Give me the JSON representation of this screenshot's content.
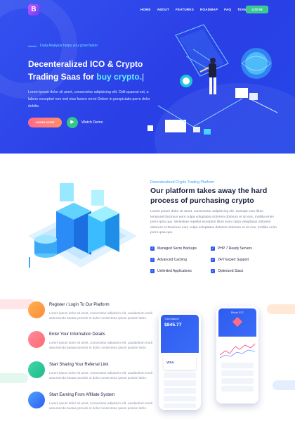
{
  "brand": {
    "logo_letter": "B"
  },
  "nav": {
    "items": [
      "HOME",
      "ABOUT",
      "FEATURES",
      "ROADMAP",
      "FAQ",
      "TEAM"
    ],
    "login_label": "LOG IN"
  },
  "hero": {
    "eyebrow": "Data Analysis helps you grow faster",
    "title_line1": "Decenteralized ICO & Crypto",
    "title_line2_prefix": "Trading Saas for ",
    "title_line2_accent": "buy crypto.",
    "paragraph": "Lorem ipsum dolor sit amet, consectetur adipisicing elit. Odit quaerat est, a labore excepturi rem sed eius facere errori Dolore in perspiciatis porro dolor debitis.",
    "learn_more": "LEARN MORE",
    "watch_demo": "Watch Demo"
  },
  "platform": {
    "eyebrow": "Decenteralized Crypto Trading Platform",
    "heading": "Our platform takes away the hard process of purchasing crypto",
    "paragraph": "Lorem ipsum dolor sit amet, consectetur adipisicing elit. Suscipit eum illum temporal Ducimus eum culpa voluptatus dolorem dolorum et sit eos, mollitia enim porro ipsa quo. Molestiae repellat excepturi illum eum culpa voluptatus dolorem dolorum et Ducimus eum culpa voluptatus dolorem dolorum et sit eos, mollitia enim porro ipsa quo.",
    "features": [
      "Managed Secre Backups",
      "PHP 7 Ready Servers",
      "Advanced Caching",
      "24/7 Expert Support",
      "Unlimited Applications",
      "Optimized Stack"
    ]
  },
  "steps": [
    {
      "title": "Register / Login To Our Platform",
      "desc": "Lorem ipsum dolor sit amet, consectetur adipisicin elit. Laudantium modi assumenda beatae provide nt dolor consectetur ipsum possim lorbs."
    },
    {
      "title": "Enter Your Information Details",
      "desc": "Lorem ipsum dolor sit amet, consectetur adipisicin elit. Laudantium modi assumenda beatae provide nt dolor consectetur ipsum possim lorbs."
    },
    {
      "title": "Start Sharing Your Referral Link",
      "desc": "Lorem ipsum dolor sit amet, consectetur adipisicin elit. Laudantium modi assumenda beatae provide nt dolor consectetur ipsum possim lorbs."
    },
    {
      "title": "Start Earning From Affiliate System",
      "desc": "Lorem ipsum dolor sit amet, consectetur adipisicin elit. Laudantium modi assumenda beatae provide nt dolor consectetur ipsum possim lorbs."
    }
  ],
  "phone1": {
    "label": "Total Balance",
    "balance": "$845.77",
    "card": "VISA"
  },
  "phone2": {
    "label": "Bitcoin BTC"
  },
  "colors": {
    "hero_blue": "#2f4cf0",
    "accent_cyan": "#5ff0ff",
    "cta_pink": "#ff6b8a",
    "login_green": "#39c98f"
  }
}
